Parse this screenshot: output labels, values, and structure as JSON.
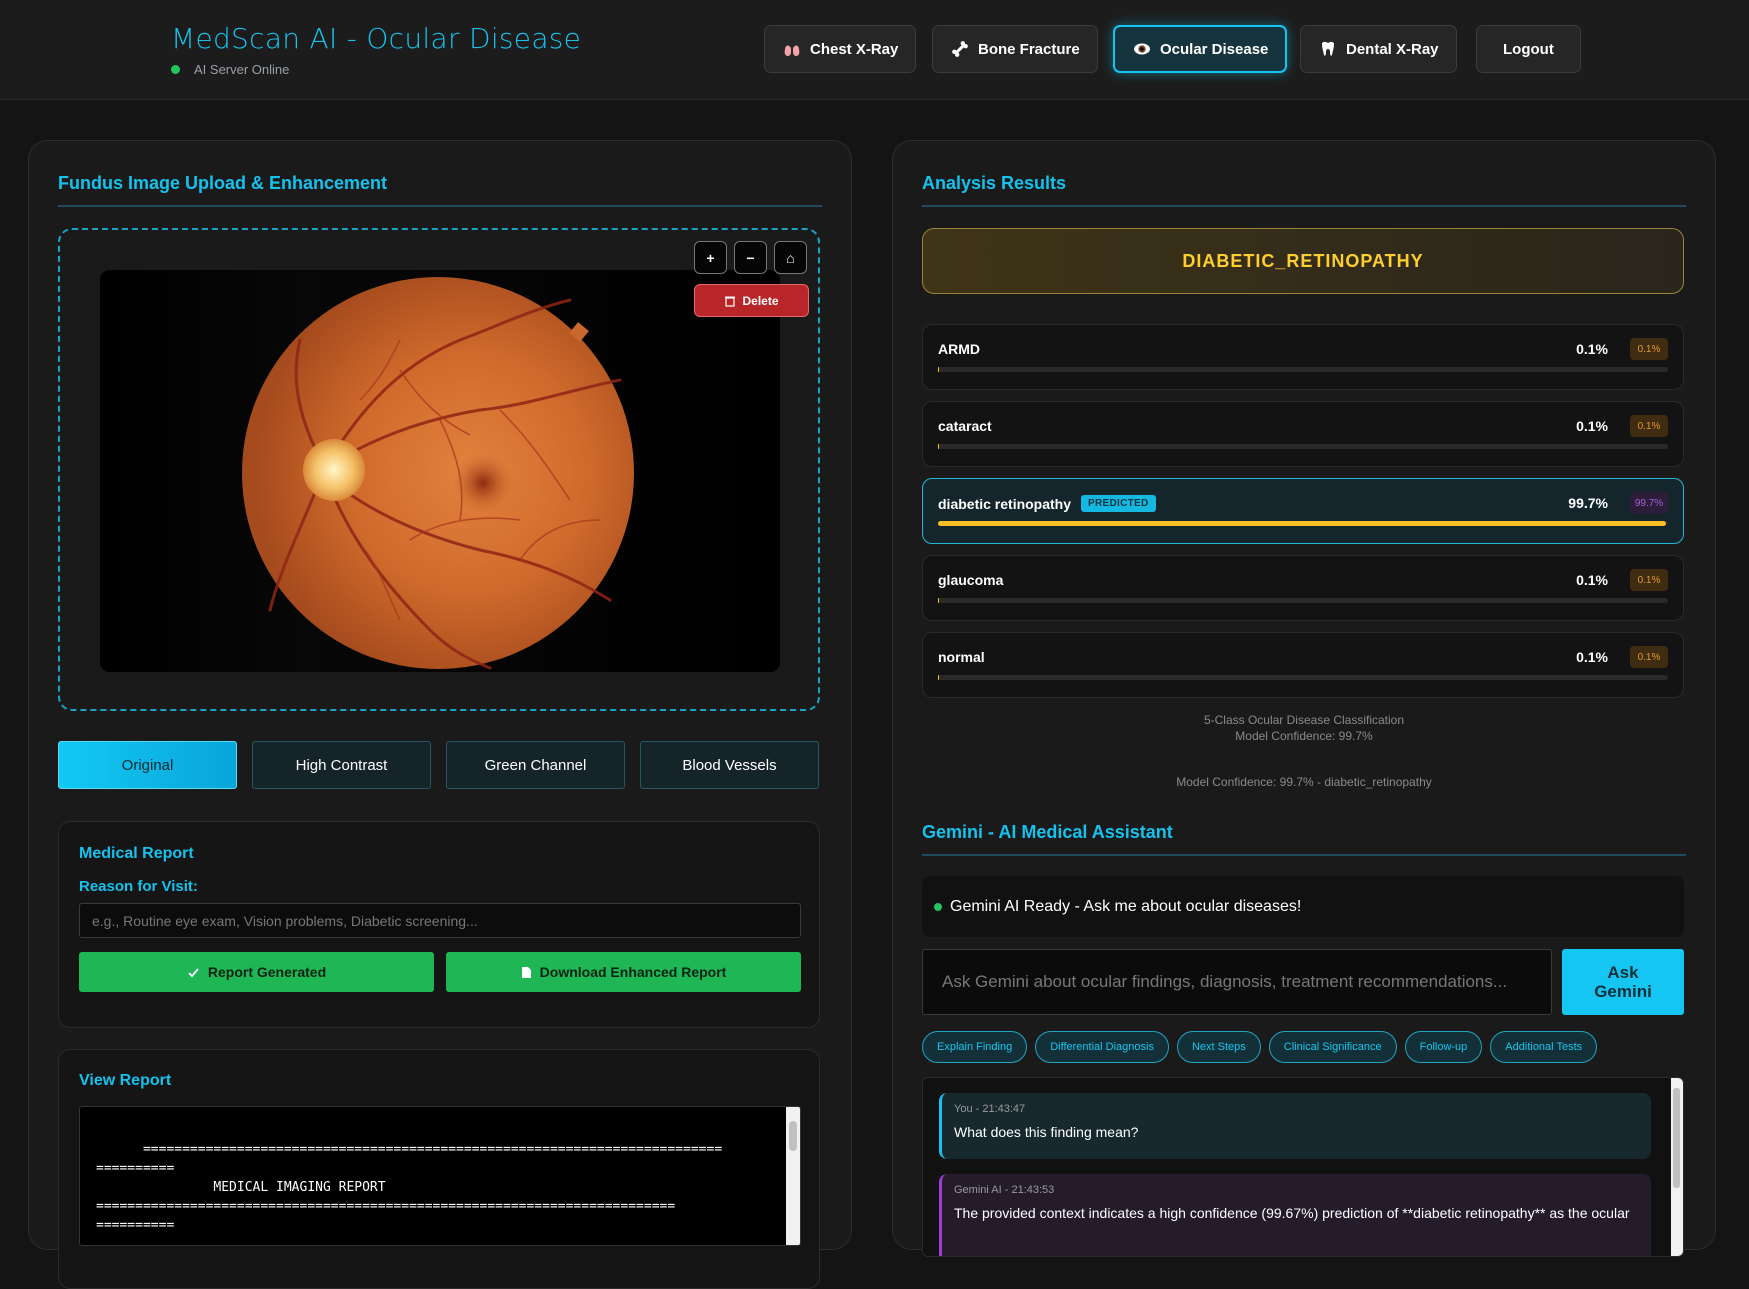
{
  "header": {
    "title": "MedScan AI - Ocular Disease",
    "server_status": "AI Server Online",
    "status_color": "#22c55e",
    "nav": {
      "chest": "Chest X-Ray",
      "bone": "Bone Fracture",
      "ocular": "Ocular Disease",
      "dental": "Dental X-Ray",
      "logout": "Logout"
    },
    "active_nav": "Ocular Disease"
  },
  "upload_panel": {
    "title": "Fundus Image Upload & Enhancement",
    "zoom_in": "+",
    "zoom_out": "−",
    "home": "⌂",
    "delete": "Delete",
    "enhancement_modes": [
      "Original",
      "High Contrast",
      "Green Channel",
      "Blood Vessels"
    ],
    "selected_mode": "Original"
  },
  "medical_report": {
    "title": "Medical Report",
    "reason_label": "Reason for Visit:",
    "reason_placeholder": "e.g., Routine eye exam, Vision problems, Diabetic screening...",
    "report_generated": "Report Generated",
    "download": "Download Enhanced Report"
  },
  "view_report": {
    "title": "View Report",
    "content": "==========================================================================\n==========\n               MEDICAL IMAGING REPORT\n==========================================================================\n=========="
  },
  "analysis": {
    "title": "Analysis Results",
    "prediction": "DIABETIC_RETINOPATHY",
    "predicted_tag": "PREDICTED",
    "classes": [
      {
        "label": "ARMD",
        "percent": "0.1%",
        "badge": "0.1%",
        "value": 0.1
      },
      {
        "label": "cataract",
        "percent": "0.1%",
        "badge": "0.1%",
        "value": 0.1
      },
      {
        "label": "diabetic retinopathy",
        "percent": "99.7%",
        "badge": "99.7%",
        "value": 99.7
      },
      {
        "label": "glaucoma",
        "percent": "0.1%",
        "badge": "0.1%",
        "value": 0.1
      },
      {
        "label": "normal",
        "percent": "0.1%",
        "badge": "0.1%",
        "value": 0.1
      }
    ],
    "classification_note": "5-Class Ocular Disease Classification",
    "confidence_note": "Model Confidence: 99.7%",
    "summary": "Model Confidence: 99.7% - diabetic_retinopathy",
    "bar_color": "#fbbf24"
  },
  "gemini": {
    "title": "Gemini - AI Medical Assistant",
    "ready": "Gemini AI Ready - Ask me about ocular diseases!",
    "input_placeholder": "Ask Gemini about ocular findings, diagnosis, treatment recommendations...",
    "ask_button": "Ask Gemini",
    "quick_actions": [
      "Explain Finding",
      "Differential Diagnosis",
      "Next Steps",
      "Clinical Significance",
      "Follow-up",
      "Additional Tests"
    ],
    "messages": [
      {
        "meta": "You - 21:43:47",
        "text": "What does this finding mean?"
      },
      {
        "meta": "Gemini AI - 21:43:53",
        "text": "The provided context indicates a high confidence (99.67%) prediction of **diabetic retinopathy** as the ocular"
      }
    ]
  }
}
